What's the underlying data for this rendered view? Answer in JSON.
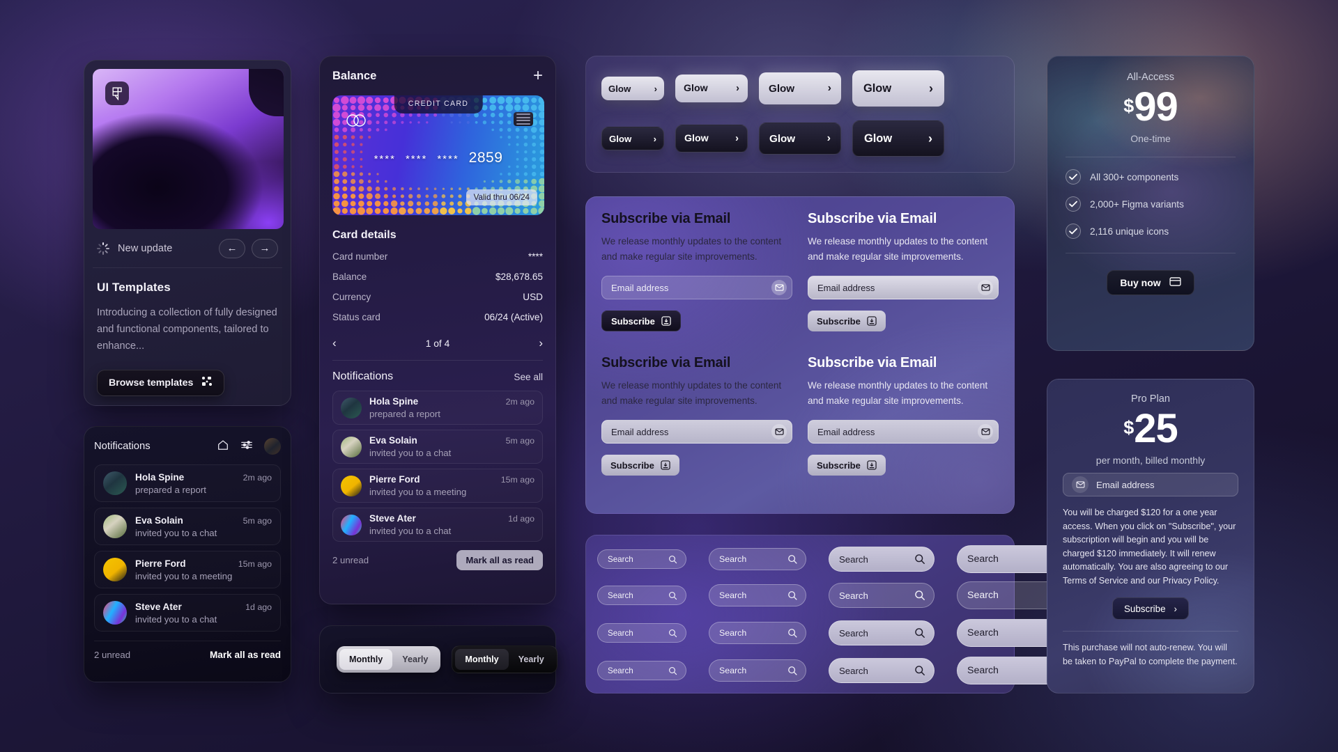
{
  "templates_card": {
    "update_label": "New update",
    "prev_icon": "arrow-left-icon",
    "next_icon": "arrow-right-icon",
    "title": "UI Templates",
    "description": "Introducing a collection of fully designed and functional components, tailored to enhance...",
    "browse_label": "Browse templates",
    "browse_icon": "components-icon",
    "badge_icon": "figma-icon",
    "spinner_icon": "loading-spinner-icon"
  },
  "notifications_left": {
    "title": "Notifications",
    "home_icon": "home-icon",
    "settings_icon": "sliders-icon",
    "avatar_icon": "avatar",
    "items": [
      {
        "name": "Hola Spine",
        "message": "prepared a report",
        "time": "2m ago"
      },
      {
        "name": "Eva Solain",
        "message": "invited you to a chat",
        "time": "5m ago"
      },
      {
        "name": "Pierre Ford",
        "message": "invited you to a meeting",
        "time": "15m ago"
      },
      {
        "name": "Steve Ater",
        "message": "invited you to a chat",
        "time": "1d ago"
      }
    ],
    "unread": "2 unread",
    "mark_all": "Mark all as read"
  },
  "balance": {
    "title": "Balance",
    "add_icon": "plus-icon",
    "credit_card": {
      "type_label": "CREDIT CARD",
      "mask_group": "****",
      "last4": "2859",
      "valid_thru": "Valid thru 06/24",
      "brand_icon": "two-circles-icon",
      "chip_icon": "chip-icon"
    },
    "details_title": "Card details",
    "details": [
      {
        "key": "Card number",
        "value": "****"
      },
      {
        "key": "Balance",
        "value": "$28,678.65"
      },
      {
        "key": "Currency",
        "value": "USD"
      },
      {
        "key": "Status card",
        "value": "06/24 (Active)"
      }
    ],
    "pager": {
      "prev_icon": "chevron-left-icon",
      "label": "1 of 4",
      "next_icon": "chevron-right-icon"
    },
    "notifications_title": "Notifications",
    "see_all": "See all",
    "items": [
      {
        "name": "Hola Spine",
        "message": "prepared a report",
        "time": "2m ago"
      },
      {
        "name": "Eva Solain",
        "message": "invited you to a chat",
        "time": "5m ago"
      },
      {
        "name": "Pierre Ford",
        "message": "invited you to a meeting",
        "time": "15m ago"
      },
      {
        "name": "Steve Ater",
        "message": "invited you to a chat",
        "time": "1d ago"
      }
    ],
    "unread": "2 unread",
    "mark_all": "Mark all as read"
  },
  "toggles": [
    {
      "style": "light",
      "selected": "Monthly",
      "options": [
        "Monthly",
        "Yearly"
      ]
    },
    {
      "style": "dark",
      "selected": "Monthly",
      "options": [
        "Monthly",
        "Yearly"
      ]
    }
  ],
  "glow_panel": {
    "label": "Glow",
    "chevron_icon": "chevron-right-icon",
    "rows": [
      {
        "variant": "light",
        "sizes": [
          "sm",
          "md",
          "lg",
          "xl"
        ]
      },
      {
        "variant": "dark",
        "sizes": [
          "sm",
          "md",
          "lg",
          "xl"
        ]
      }
    ]
  },
  "subscribe_panel": {
    "cards": [
      {
        "title": "Subscribe via Email",
        "body": "We release monthly updates to the content and make regular site improvements.",
        "placeholder": "Email address",
        "button": "Subscribe",
        "heading_style": "dark",
        "input_style": "glassy",
        "button_style": "darkb"
      },
      {
        "title": "Subscribe via Email",
        "body": "We release monthly updates to the content and make regular site improvements.",
        "placeholder": "Email address",
        "button": "Subscribe",
        "heading_style": "lightc",
        "input_style": "solidlight",
        "button_style": "lightb"
      },
      {
        "title": "Subscribe via Email",
        "body": "We release monthly updates to the content and make regular site improvements.",
        "placeholder": "Email address",
        "button": "Subscribe",
        "heading_style": "dark",
        "input_style": "palelight",
        "button_style": "lightb"
      },
      {
        "title": "Subscribe via Email",
        "body": "We release monthly updates to the content and make regular site improvements.",
        "placeholder": "Email address",
        "button": "Subscribe",
        "heading_style": "lightc",
        "input_style": "palelight",
        "button_style": "lightb"
      }
    ],
    "mail_icon": "envelope-icon",
    "subscribe_icon": "inbox-download-icon"
  },
  "search_panel": {
    "placeholder": "Search",
    "search_icon": "magnifier-icon",
    "rows": 4,
    "cols": 4
  },
  "all_access": {
    "plan_name": "All-Access",
    "currency": "$",
    "amount": "99",
    "period": "One-time",
    "features": [
      "All 300+ components",
      "2,000+ Figma variants",
      "2,116 unique icons"
    ],
    "check_icon": "check-icon",
    "cta": "Buy now",
    "cta_icon": "credit-card-icon"
  },
  "pro_plan": {
    "plan_name": "Pro Plan",
    "currency": "$",
    "amount": "25",
    "period": "per month, billed monthly",
    "email_placeholder": "Email address",
    "mail_icon": "envelope-icon",
    "legal": "You will be charged $120 for a one year access. When you click on \"Subscribe\", your subscription will begin and you will be charged $120 immediately. It will renew automatically. You are also agreeing to our Terms of Service and our Privacy Policy.",
    "cta": "Subscribe",
    "cta_icon": "chevron-right-icon",
    "fine_print": "This purchase will not auto-renew. You will be taken to PayPal to complete the payment."
  }
}
